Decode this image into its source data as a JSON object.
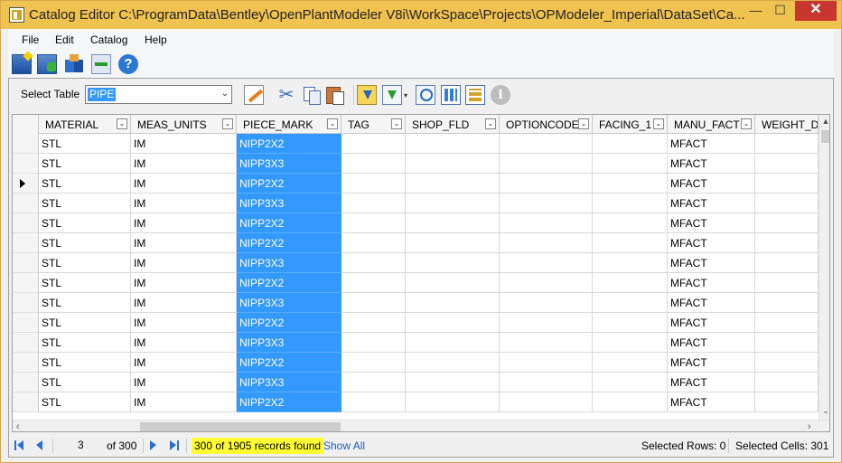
{
  "window": {
    "title": "Catalog Editor C:\\ProgramData\\Bentley\\OpenPlantModeler V8i\\WorkSpace\\Projects\\OPModeler_Imperial\\DataSet\\Ca...",
    "min_glyph": "—",
    "max_glyph": "☐",
    "close_glyph": "✕"
  },
  "menu": {
    "file": "File",
    "edit": "Edit",
    "catalog": "Catalog",
    "help": "Help"
  },
  "toolbar": {
    "help_glyph": "?",
    "cut_glyph": "✂",
    "info_glyph": "i",
    "dropdown_glyph": "▾",
    "icons": [
      "new-catalog-icon",
      "import-icon",
      "components-icon",
      "merge-icon",
      "help-icon",
      "edit-table-icon",
      "cut-icon",
      "copy-icon",
      "paste-icon",
      "filter-icon",
      "filter-column-icon",
      "find-icon",
      "columns-icon",
      "add-column-icon",
      "info-icon"
    ]
  },
  "select_table": {
    "label": "Select Table",
    "value": "PIPE",
    "arrow": "⌄"
  },
  "grid": {
    "filter_glyph": "⌄",
    "columns": [
      {
        "key": "material",
        "label": "MATERIAL"
      },
      {
        "key": "meas_units",
        "label": "MEAS_UNITS"
      },
      {
        "key": "piece_mark",
        "label": "PIECE_MARK"
      },
      {
        "key": "tag",
        "label": "TAG"
      },
      {
        "key": "shop_fld",
        "label": "SHOP_FLD"
      },
      {
        "key": "optioncode",
        "label": "OPTIONCODE"
      },
      {
        "key": "facing_1",
        "label": "FACING_1"
      },
      {
        "key": "manu_fact",
        "label": "MANU_FACT"
      },
      {
        "key": "weight_dry",
        "label": "WEIGHT_DR"
      }
    ],
    "rows": [
      [
        "STL",
        "IM",
        "NIPP2X2",
        "",
        "",
        "",
        "",
        "MFACT",
        ""
      ],
      [
        "STL",
        "IM",
        "NIPP3X3",
        "",
        "",
        "",
        "",
        "MFACT",
        ""
      ],
      [
        "STL",
        "IM",
        "NIPP2X2",
        "",
        "",
        "",
        "",
        "MFACT",
        ""
      ],
      [
        "STL",
        "IM",
        "NIPP3X3",
        "",
        "",
        "",
        "",
        "MFACT",
        ""
      ],
      [
        "STL",
        "IM",
        "NIPP2X2",
        "",
        "",
        "",
        "",
        "MFACT",
        ""
      ],
      [
        "STL",
        "IM",
        "NIPP2X2",
        "",
        "",
        "",
        "",
        "MFACT",
        ""
      ],
      [
        "STL",
        "IM",
        "NIPP3X3",
        "",
        "",
        "",
        "",
        "MFACT",
        ""
      ],
      [
        "STL",
        "IM",
        "NIPP2X2",
        "",
        "",
        "",
        "",
        "MFACT",
        ""
      ],
      [
        "STL",
        "IM",
        "NIPP3X3",
        "",
        "",
        "",
        "",
        "MFACT",
        ""
      ],
      [
        "STL",
        "IM",
        "NIPP2X2",
        "",
        "",
        "",
        "",
        "MFACT",
        ""
      ],
      [
        "STL",
        "IM",
        "NIPP3X3",
        "",
        "",
        "",
        "",
        "MFACT",
        ""
      ],
      [
        "STL",
        "IM",
        "NIPP2X2",
        "",
        "",
        "",
        "",
        "MFACT",
        ""
      ],
      [
        "STL",
        "IM",
        "NIPP3X3",
        "",
        "",
        "",
        "",
        "MFACT",
        ""
      ],
      [
        "STL",
        "IM",
        "NIPP2X2",
        "",
        "",
        "",
        "",
        "MFACT",
        ""
      ]
    ],
    "current_row_index": 2,
    "selected_column_index": 2,
    "selection_color": "#3399ff",
    "scroll_up": "▲",
    "scroll_down": "⌄",
    "scroll_left": "‹",
    "scroll_right": "›"
  },
  "navigator": {
    "page": "3",
    "of_total": "of 300",
    "records": "300 of 1905 records found",
    "records_highlight": "#ffff33",
    "show_all": "Show All",
    "selected_rows": "Selected Rows:  0",
    "selected_cells": "Selected Cells:  301"
  }
}
